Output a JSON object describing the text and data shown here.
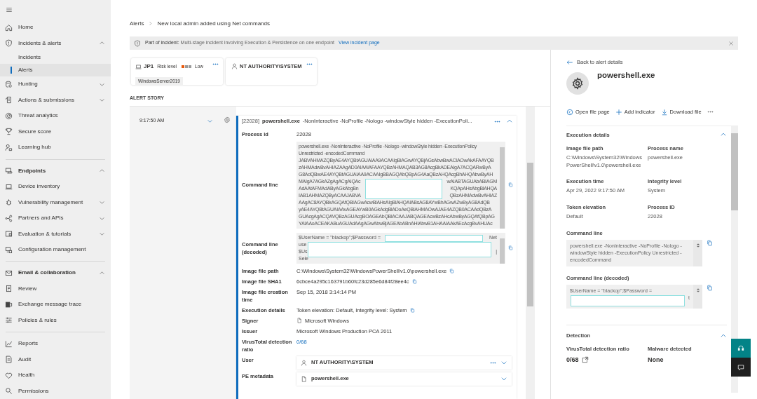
{
  "sidebar": {
    "items": [
      {
        "label": "Home",
        "kind": "item",
        "selected": false
      },
      {
        "label": "Incidents & alerts",
        "kind": "item",
        "selected": false,
        "expanded": true
      },
      {
        "label": "Incidents",
        "kind": "subitem",
        "selected": false
      },
      {
        "label": "Alerts",
        "kind": "subitem",
        "selected": true
      },
      {
        "label": "Hunting",
        "kind": "item",
        "selected": false,
        "expanded": false
      },
      {
        "label": "Actions & submissions",
        "kind": "item",
        "selected": false,
        "expanded": false
      },
      {
        "label": "Threat analytics",
        "kind": "item",
        "selected": false
      },
      {
        "label": "Secure score",
        "kind": "item",
        "selected": false
      },
      {
        "label": "Learning hub",
        "kind": "item",
        "selected": false
      },
      {
        "label": "Endpoints",
        "kind": "section",
        "selected": false,
        "expanded": true
      },
      {
        "label": "Device inventory",
        "kind": "item",
        "selected": false
      },
      {
        "label": "Vulnerability management",
        "kind": "item",
        "selected": false,
        "expanded": false
      },
      {
        "label": "Partners and APIs",
        "kind": "item",
        "selected": false,
        "expanded": false
      },
      {
        "label": "Evaluation & tutorials",
        "kind": "item",
        "selected": false,
        "expanded": false
      },
      {
        "label": "Configuration management",
        "kind": "item",
        "selected": false
      },
      {
        "label": "Email & collaboration",
        "kind": "section",
        "selected": false,
        "expanded": true
      },
      {
        "label": "Review",
        "kind": "item",
        "selected": false
      },
      {
        "label": "Exchange message trace",
        "kind": "item",
        "selected": false
      },
      {
        "label": "Policies & rules",
        "kind": "item",
        "selected": false
      },
      {
        "label": "Reports",
        "kind": "group-start",
        "selected": false
      },
      {
        "label": "Audit",
        "kind": "item",
        "selected": false
      },
      {
        "label": "Health",
        "kind": "item",
        "selected": false
      },
      {
        "label": "Permissions",
        "kind": "item",
        "selected": false
      }
    ]
  },
  "breadcrumb": [
    "Alerts",
    "New local admin added using Net commands"
  ],
  "incident_banner": {
    "label": "Part of incident:",
    "text": "Multi-stage incident involving Execution & Persistence on one endpoint",
    "link": "View incident page"
  },
  "device_card": {
    "name": "JP1",
    "risk_label": "Risk level",
    "risk": "Low",
    "level": 0.33,
    "tag": "WindowsServer2019"
  },
  "user_card": {
    "name": "NT AUTHORITY\\SYSTEM"
  },
  "alert_story": {
    "heading": "ALERT STORY",
    "time": "9:17:50 AM",
    "process": {
      "pid": "[22028]",
      "name": "powershell.exe",
      "args": "-NonInteractive -NoProfile -Nologo -windowStyle hidden -ExecutionPoli...",
      "expanded": true,
      "fields": [
        {
          "kind": "text",
          "label": "Process id",
          "value": "22028"
        },
        {
          "kind": "textarea",
          "label": "Command line",
          "copyable": true,
          "redacted": true,
          "lines": [
            {
              "left": "powershell.exe -NonInteractive -NoProfile -Nologo -windowStyle hidden -ExecutionPolicy"
            },
            {
              "left": "Unrestricted -encodedCommand"
            },
            {
              "left": "JABVAHMAZQByAE4AYQBtAGUAIAA9ACAAIgBiAGwAYQBjAGsAbwBwACIAOwAkAFAAYQB"
            },
            {
              "left": "zAHMAdwBvAHIAZAAgAD0AIAAiAFAAYQBzAHMAQAB3AG8AcgBkADEAIgA7ACQARwByA"
            },
            {
              "left": "G8AdQBwAE4AYQBtAGUAIAA9ACAAIgBBAGQAbQBpAG4AaQBzAHQAcgBhAHQAbwByAH"
            },
            {
              "left": "MAIgA7AGkAZgAgACgAIQAc",
              "right": "wAIABTAGUAbABIAGM"
            },
            {
              "left": "AdAAtAFMAdAByAGkAbgBn",
              "right": "KQApAHsAbgBlAHQA"
            },
            {
              "left": "IAB1AHMAZQByACAAJABVA",
              "right": "QBzAHMAdwBvAHIAZ"
            },
            {
              "left": "AAgAC8AYQBkAGQAfQBIAGwAcwBlAHsAIgBlAHQAIABsAG8AYwBhAGwAZwByAG8AdQB"
            },
            {
              "left": "yAE4AYQBtAGUAIAAvAGEAYwB0AGkAdgBlADoAeQBlAHMAOwAJAE4AZQB0ACAAdQBzA"
            },
            {
              "left": "GUAcgAgACQAVQBzAGUAcgBOAGEAbQBlACAAJABQAGEAcwBzAHcAbwByAGQAfQBpAG"
            },
            {
              "left": "YAIAAoACEAKABuAGUAdAAgAGwAbwBjAGEAbABnAHIAbwB1AHAAIAAkAEcAcgBvAHUAc"
            }
          ]
        },
        {
          "kind": "textarea",
          "label": "Command line (decoded)",
          "copyable": true,
          "redacted": true,
          "lines": [
            {
              "left": "$UserName = \"blackop\";$Password =",
              "right": "Net"
            },
            {
              "left": "use"
            },
            {
              "left": "$Us",
              "right": "|"
            },
            {
              "left": "Sele"
            }
          ]
        },
        {
          "kind": "text",
          "label": "Image file path",
          "value": "C:\\Windows\\System32\\WindowsPowerShell\\v1.0\\powershell.exe",
          "copyable": true
        },
        {
          "kind": "text",
          "label": "Image file SHA1",
          "value": "6cbce4a295c163791b60fc23d285e6d84f28ee4c",
          "copyable": true
        },
        {
          "kind": "text",
          "label": "Image file creation time",
          "value": "Sep 15, 2018 3:14:14 PM"
        },
        {
          "kind": "text",
          "label": "Execution details",
          "value": "Token elevation: Default, Integrity level: System",
          "copyable": true
        },
        {
          "kind": "signer",
          "label": "Signer",
          "value": "Microsoft Windows"
        },
        {
          "kind": "text",
          "label": "Issuer",
          "value": "Microsoft Windows Production PCA 2011"
        },
        {
          "kind": "link",
          "label": "VirusTotal detection ratio",
          "value": "0/68"
        },
        {
          "kind": "user",
          "label": "User",
          "value": "NT AUTHORITY\\SYSTEM"
        },
        {
          "kind": "file",
          "label": "PE metadata",
          "value": "powershell.exe"
        }
      ]
    }
  },
  "side_panel": {
    "back": "Back to alert details",
    "title": "powershell.exe",
    "actions": [
      {
        "kind": "open",
        "label": "Open file page"
      },
      {
        "kind": "add",
        "label": "Add indicator"
      },
      {
        "kind": "download",
        "label": "Download file"
      }
    ],
    "sections": [
      {
        "title": "Execution details",
        "expanded": true,
        "items": [
          {
            "kind": "pair",
            "cells": [
              {
                "label": "Image file path",
                "value": "C:\\Windows\\System32\\WindowsPowerShell\\v1.0\\powershell.exe"
              },
              {
                "label": "Process name",
                "value": "powershell.exe"
              }
            ]
          },
          {
            "kind": "pair",
            "cells": [
              {
                "label": "Execution time",
                "value": "Apr 29, 2022 9:17:50 AM"
              },
              {
                "label": "Integrity level",
                "value": "System"
              }
            ]
          },
          {
            "kind": "pair",
            "cells": [
              {
                "label": "Token elevation",
                "value": "Default"
              },
              {
                "label": "Process ID",
                "value": "22028"
              }
            ]
          },
          {
            "kind": "textarea",
            "label": "Command line",
            "redacted": false,
            "lines": [
              {
                "left": "powershell.exe -NonInteractive -NoProfile -Nologo -"
              },
              {
                "left": "windowStyle hidden -ExecutionPolicy Unrestricted -"
              },
              {
                "left": "encodedCommand"
              }
            ]
          },
          {
            "kind": "textarea",
            "label": "Command line (decoded)",
            "redacted": true,
            "lines": [
              {
                "left": "$UserName = \"blackop\";$Password ="
              },
              {
                "right": "t"
              }
            ]
          }
        ]
      },
      {
        "title": "Detection",
        "expanded": true,
        "items": [
          {
            "kind": "bold-pair",
            "cells": [
              {
                "label": "VirusTotal detection ratio",
                "value": "0/68",
                "external": true
              },
              {
                "label": "Malware detected",
                "value": "None"
              }
            ]
          }
        ]
      }
    ]
  }
}
